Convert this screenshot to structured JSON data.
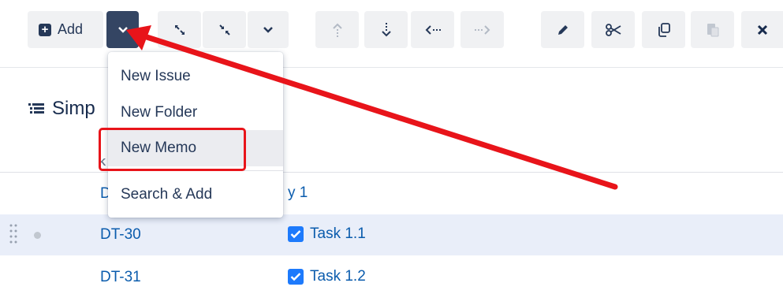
{
  "toolbar": {
    "add_label": "Add",
    "buttons": [
      {
        "name": "expand-icon"
      },
      {
        "name": "collapse-icon"
      },
      {
        "name": "chevron-down-icon"
      },
      {
        "name": "move-up-icon"
      },
      {
        "name": "move-down-icon"
      },
      {
        "name": "outdent-icon"
      },
      {
        "name": "indent-icon"
      },
      {
        "name": "pencil-icon"
      },
      {
        "name": "scissors-icon"
      },
      {
        "name": "copy-icon"
      },
      {
        "name": "paste-icon"
      },
      {
        "name": "close-icon"
      }
    ]
  },
  "page": {
    "title": "Simp",
    "column_header": "K"
  },
  "rows": [
    {
      "key": "D",
      "summary": "y 1"
    },
    {
      "key": "DT-30",
      "summary": "Task 1.1",
      "checked": true
    },
    {
      "key": "DT-31",
      "summary": "Task 1.2",
      "checked": true
    }
  ],
  "menu": {
    "items": [
      "New Issue",
      "New Folder",
      "New Memo",
      "Search & Add"
    ]
  },
  "colors": {
    "accent": "#344563",
    "link": "#0b5cad",
    "annotation": "#e8141a",
    "row_highlight": "#e9eef9"
  }
}
